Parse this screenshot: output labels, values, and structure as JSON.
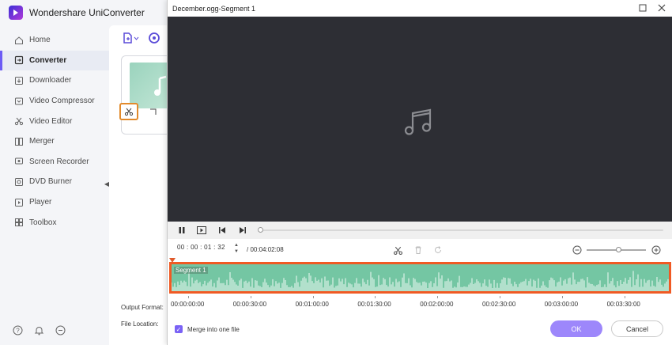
{
  "app": {
    "title": "Wondershare UniConverter"
  },
  "sidebar": {
    "items": [
      {
        "label": "Home",
        "icon": "home-icon"
      },
      {
        "label": "Converter",
        "icon": "converter-icon",
        "active": true
      },
      {
        "label": "Downloader",
        "icon": "downloader-icon"
      },
      {
        "label": "Video Compressor",
        "icon": "compress-icon"
      },
      {
        "label": "Video Editor",
        "icon": "scissors-icon"
      },
      {
        "label": "Merger",
        "icon": "merger-icon"
      },
      {
        "label": "Screen Recorder",
        "icon": "recorder-icon"
      },
      {
        "label": "DVD Burner",
        "icon": "disc-icon"
      },
      {
        "label": "Player",
        "icon": "player-icon"
      },
      {
        "label": "Toolbox",
        "icon": "toolbox-icon"
      }
    ]
  },
  "content": {
    "output_format_label": "Output Format:",
    "file_location_label": "File Location:"
  },
  "dialog": {
    "title": "December.ogg-Segment 1",
    "time": {
      "current": "00 : 00 : 01 : 32",
      "total": "/ 00:04:02:08"
    },
    "segment_label": "Segment 1",
    "timeline_ticks": [
      "00:00:00:00",
      "00:00:30:00",
      "00:01:00:00",
      "00:01:30:00",
      "00:02:00:00",
      "00:02:30:00",
      "00:03:00:00",
      "00:03:30:00"
    ],
    "merge_label": "Merge into one file",
    "merge_checked": true,
    "ok_label": "OK",
    "cancel_label": "Cancel"
  },
  "colors": {
    "accent": "#7a62f5",
    "segment_border": "#f05a24",
    "waveform_bg": "#74c6a3",
    "video_bg": "#2d2e34"
  }
}
